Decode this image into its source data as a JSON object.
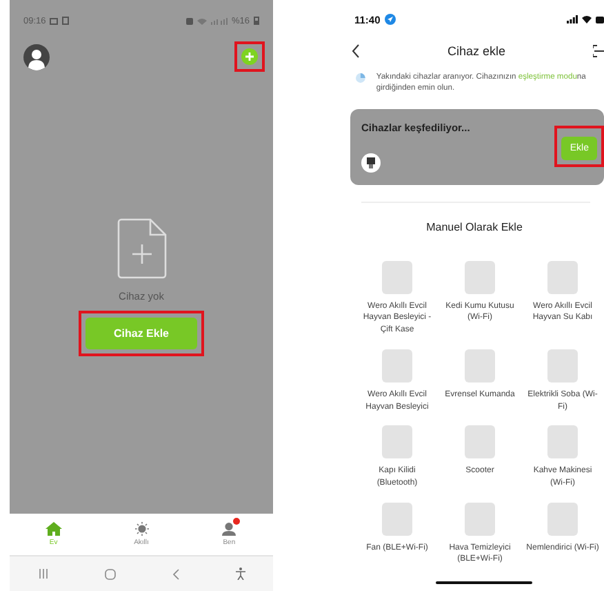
{
  "home_screen": {
    "status_bar": {
      "time": "09:16",
      "battery": "%16"
    },
    "add_button": {
      "highlighted": true
    },
    "empty_state": {
      "message": "Cihaz yok",
      "button": {
        "label": "Cihaz Ekle",
        "highlighted": true
      }
    },
    "tabs": [
      {
        "label": "Ev",
        "selected": true,
        "notification": false
      },
      {
        "label": "Akıllı",
        "selected": false,
        "notification": false
      },
      {
        "label": "Ben",
        "selected": false,
        "notification": true
      }
    ]
  },
  "add_device_screen": {
    "status_bar": {
      "time": "11:40"
    },
    "title": "Cihaz ekle",
    "notice": [
      {
        "text": "Yakındaki cihazlar aranıyor. Cihazınızın ",
        "link": false
      },
      {
        "text": "eşleştirme modu",
        "link": true
      },
      {
        "text": "na girdiğinden emin olun.",
        "link": false
      }
    ],
    "discovery": {
      "title": "Cihazlar keşfediliyor...",
      "button": {
        "label": "Ekle",
        "highlighted": true
      }
    },
    "section_title": "Manuel Olarak Ekle",
    "devices": [
      {
        "name": "Wero Akıllı Evcil Hayvan Besleyici - Çift Kase"
      },
      {
        "name": "Kedi Kumu Kutusu (Wi-Fi)"
      },
      {
        "name": "Wero Akıllı Evcil Hayvan Su Kabı"
      },
      {
        "name": "Wero Akıllı Evcil Hayvan Besleyici"
      },
      {
        "name": "Evrensel Kumanda"
      },
      {
        "name": "Elektrikli Soba (Wi-Fi)"
      },
      {
        "name": "Kapı Kilidi (Bluetooth)"
      },
      {
        "name": "Scooter"
      },
      {
        "name": "Kahve Makinesi (Wi-Fi)"
      },
      {
        "name": "Fan (BLE+Wi-Fi)"
      },
      {
        "name": "Hava Temizleyici (BLE+Wi-Fi)"
      },
      {
        "name": "Nemlendirici (Wi-Fi)"
      }
    ]
  }
}
